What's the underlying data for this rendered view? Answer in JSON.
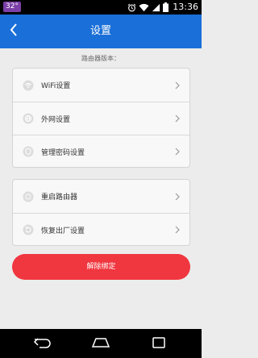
{
  "status_bar": {
    "temperature": "32°",
    "time": "13:36"
  },
  "header": {
    "title": "设置"
  },
  "router_version_label": "路由器版本：",
  "groups": [
    {
      "items": [
        {
          "label": "WiFi设置",
          "icon": "wifi-icon"
        },
        {
          "label": "外网设置",
          "icon": "globe-icon"
        },
        {
          "label": "管理密码设置",
          "icon": "shield-icon"
        }
      ]
    },
    {
      "items": [
        {
          "label": "重启路由器",
          "icon": "restart-icon"
        },
        {
          "label": "恢复出厂设置",
          "icon": "reset-icon"
        }
      ]
    }
  ],
  "unbind_button": "解除绑定",
  "colors": {
    "header": "#1a6fd8",
    "unbind": "#f0363f",
    "background": "#ececec"
  }
}
